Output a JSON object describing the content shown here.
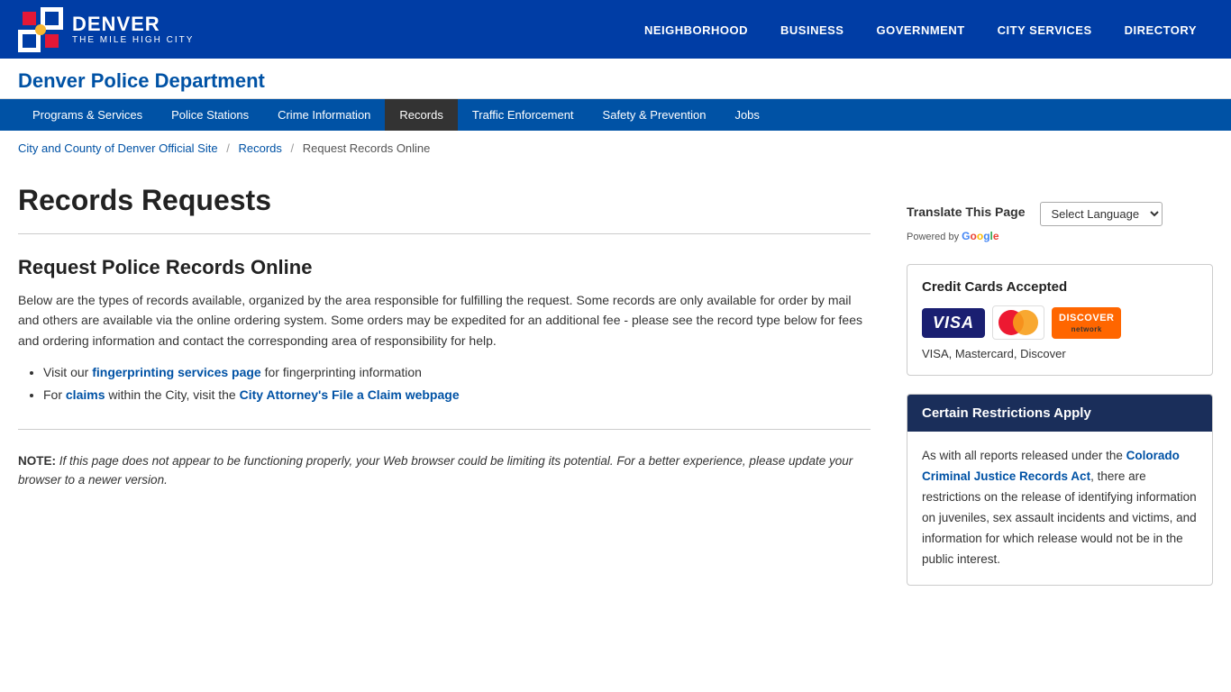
{
  "topNav": {
    "logoLine1": "DENVER",
    "logoLine2": "THE MILE HIGH CITY",
    "links": [
      {
        "label": "NEIGHBORHOOD",
        "url": "#"
      },
      {
        "label": "BUSINESS",
        "url": "#"
      },
      {
        "label": "GOVERNMENT",
        "url": "#"
      },
      {
        "label": "CITY SERVICES",
        "url": "#"
      },
      {
        "label": "DIRECTORY",
        "url": "#"
      }
    ]
  },
  "deptHeader": {
    "title": "Denver Police Department"
  },
  "subNav": {
    "items": [
      {
        "label": "Programs & Services",
        "active": false
      },
      {
        "label": "Police Stations",
        "active": false
      },
      {
        "label": "Crime Information",
        "active": false
      },
      {
        "label": "Records",
        "active": true
      },
      {
        "label": "Traffic Enforcement",
        "active": false
      },
      {
        "label": "Safety & Prevention",
        "active": false
      },
      {
        "label": "Jobs",
        "active": false
      }
    ]
  },
  "breadcrumb": {
    "items": [
      {
        "label": "City and County of Denver Official Site",
        "url": "#"
      },
      {
        "label": "Records",
        "url": "#"
      },
      {
        "label": "Request Records Online",
        "url": null
      }
    ]
  },
  "main": {
    "pageTitle": "Records Requests",
    "sectionTitle": "Request Police Records Online",
    "sectionBody": "Below are the types of records available, organized by the area responsible for fulfilling the request.  Some records are only available for order by mail and others are available via the online ordering system.  Some orders may be expedited for an additional fee - please see the record type below for fees and ordering information and contact the corresponding area of responsibility for help.",
    "bullets": [
      {
        "text": "Visit our ",
        "linkText": "fingerprinting services page",
        "textAfter": " for fingerprinting information"
      },
      {
        "text": "For ",
        "linkText": "claims",
        "textMiddle": " within the City, visit the ",
        "linkText2": "City Attorney's File a Claim webpage",
        "textAfter": ""
      }
    ],
    "noteLabel": "NOTE:",
    "noteText": " If this page does not appear to be functioning properly, your Web browser could be limiting its potential.  For a better experience, please update your browser to a newer version."
  },
  "sidebar": {
    "translateLabel": "Translate This Page",
    "selectLanguagePlaceholder": "Select Language",
    "poweredBy": "Powered by",
    "creditCard": {
      "title": "Credit Cards Accepted",
      "names": "VISA, Mastercard, Discover"
    },
    "restrictions": {
      "header": "Certain Restrictions Apply",
      "bodyStart": "As with all reports released under the ",
      "actLink": "Colorado Criminal Justice Records Act",
      "bodyEnd": ", there are restrictions on the release of identifying information on juveniles, sex assault incidents and victims, and information for which release would not be in the public interest."
    }
  }
}
